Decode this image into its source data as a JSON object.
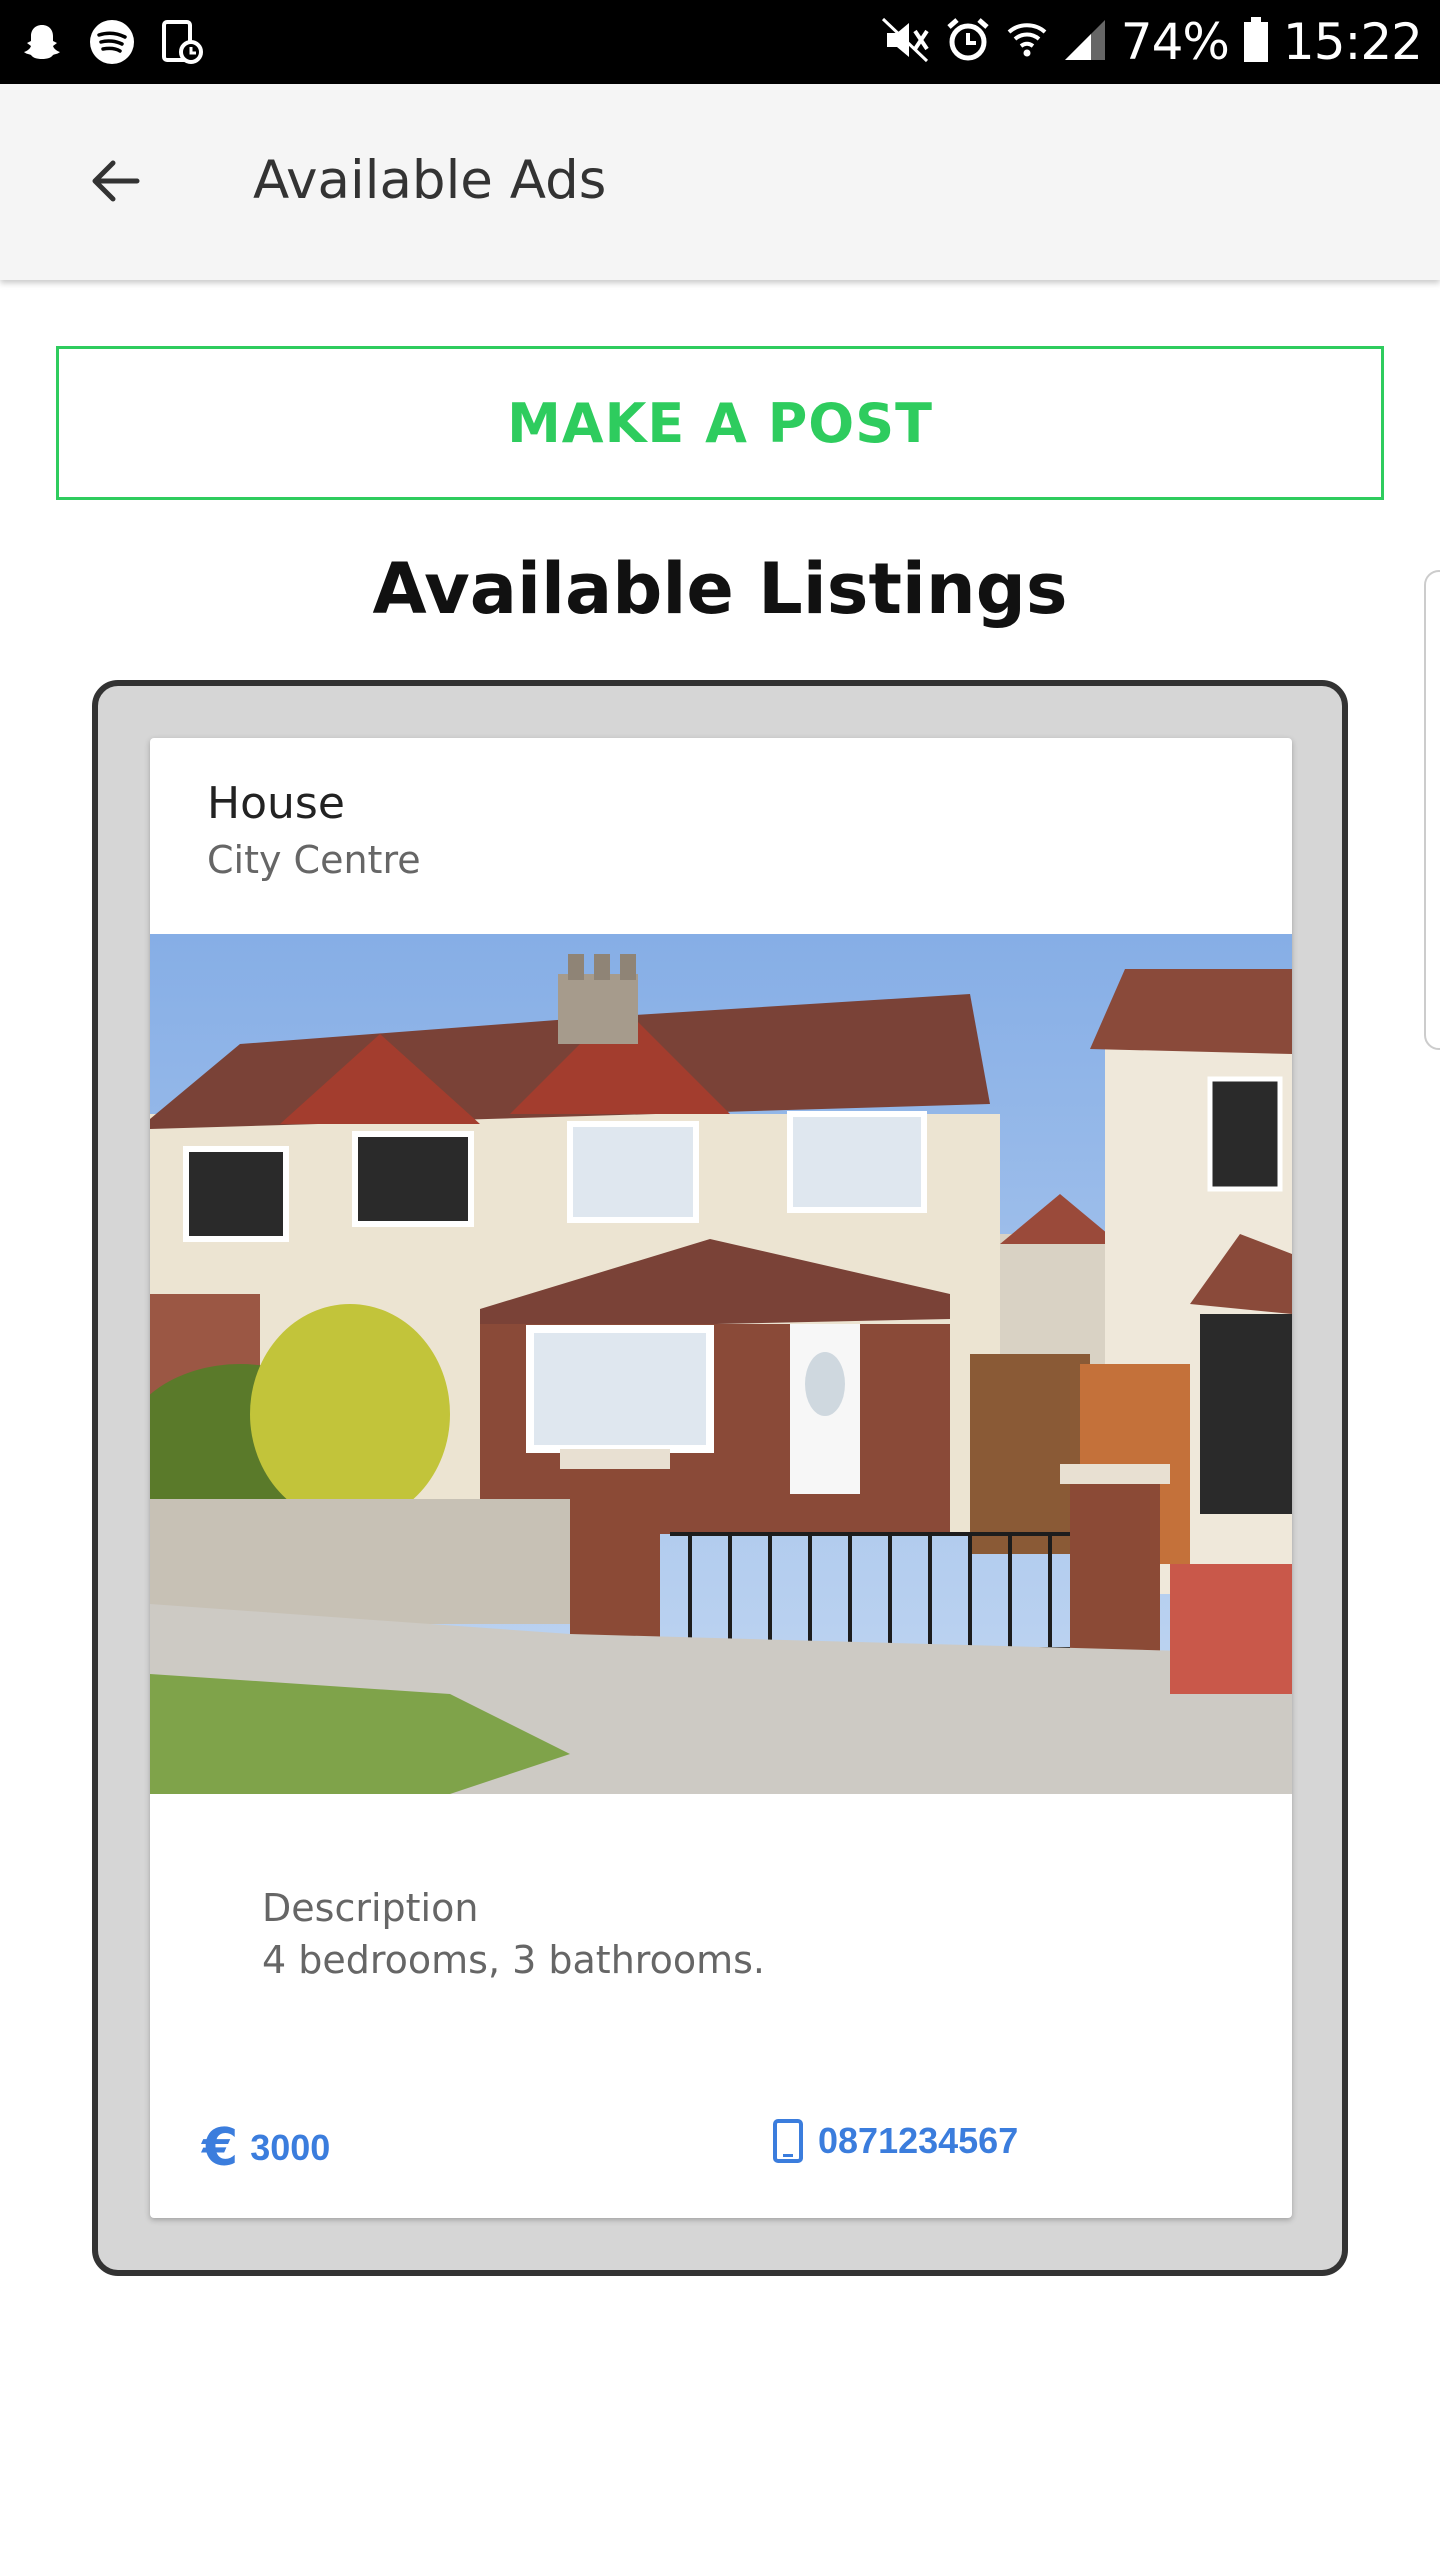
{
  "status_bar": {
    "battery": "74%",
    "time": "15:22",
    "icons_left": [
      "snapchat-icon",
      "spotify-icon",
      "screen-time-icon"
    ],
    "icons_right": [
      "mute-icon",
      "alarm-icon",
      "wifi-icon",
      "signal-icon",
      "battery-icon"
    ]
  },
  "app_bar": {
    "title": "Available Ads",
    "back_icon": "arrow-left-icon"
  },
  "actions": {
    "make_post_label": "MAKE A POST"
  },
  "section": {
    "title": "Available Listings"
  },
  "listing": {
    "type": "House",
    "location": "City Centre",
    "description_label": "Description",
    "description": "4 bedrooms, 3 bathrooms.",
    "price": "3000",
    "currency_symbol": "€",
    "phone": "0871234567"
  },
  "colors": {
    "accent_green": "#2ecc5e",
    "link_blue": "#3b7ddd",
    "frame_gray": "#d6d6d6"
  }
}
